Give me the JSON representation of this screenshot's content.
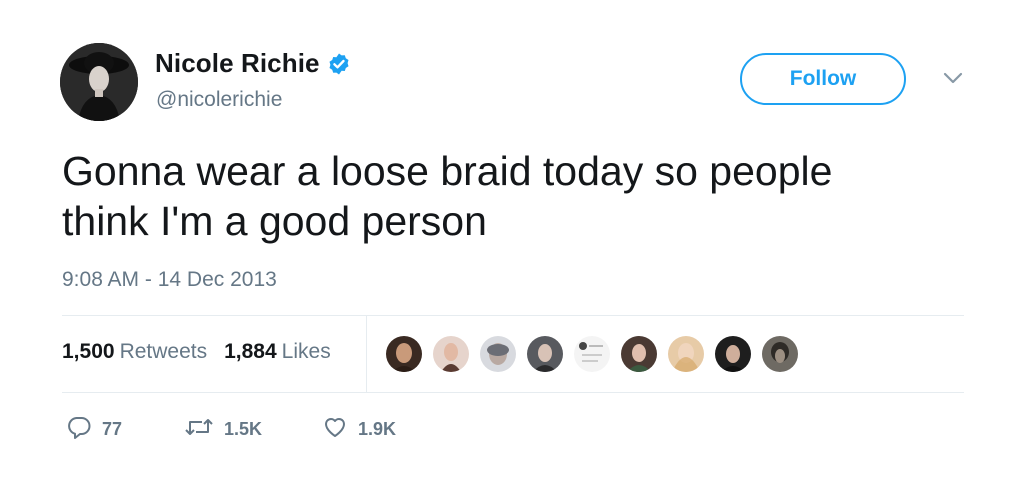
{
  "author": {
    "display_name": "Nicole Richie",
    "handle": "@nicolerichie",
    "verified": true,
    "avatar_icon": "profile-photo"
  },
  "header": {
    "follow_label": "Follow",
    "menu_icon": "chevron-down-icon"
  },
  "tweet": {
    "text_line1": "Gonna wear a loose braid today so people",
    "text_line2": "think I'm a good person",
    "timestamp": "9:08 AM - 14 Dec 2013"
  },
  "stats": {
    "retweets_count": "1,500",
    "retweets_label": "Retweets",
    "likes_count": "1,884",
    "likes_label": "Likes",
    "liker_avatars": 9
  },
  "actions": {
    "reply_count": "77",
    "retweet_count": "1.5K",
    "like_count": "1.9K"
  },
  "colors": {
    "accent": "#1da1f2",
    "text": "#14171a",
    "secondary": "#657786",
    "divider": "#e6ecf0"
  }
}
